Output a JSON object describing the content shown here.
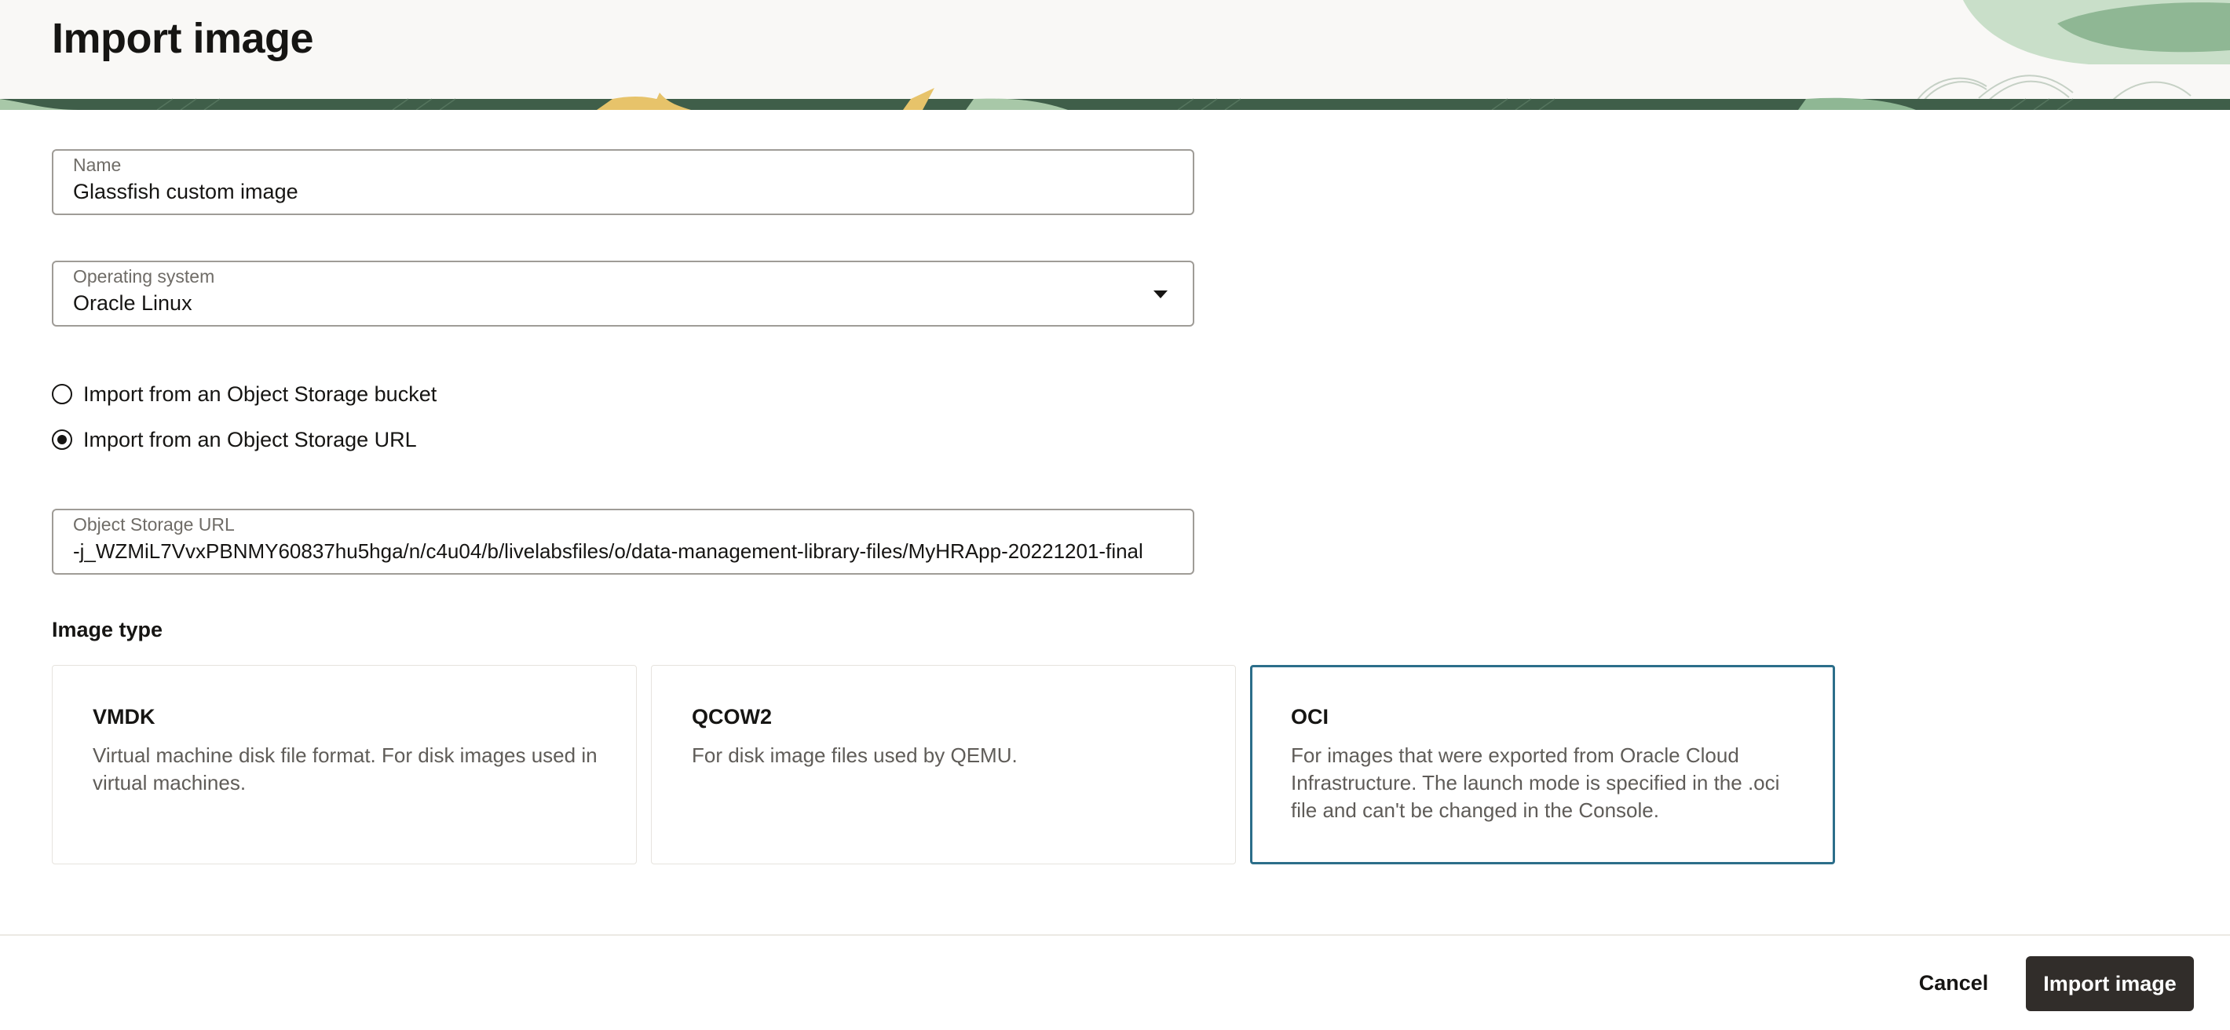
{
  "header": {
    "title": "Import image"
  },
  "form": {
    "name": {
      "label": "Name",
      "value": "Glassfish custom image"
    },
    "os": {
      "label": "Operating system",
      "value": "Oracle Linux"
    },
    "source": {
      "options": [
        {
          "label": "Import from an Object Storage bucket",
          "checked": false
        },
        {
          "label": "Import from an Object Storage URL",
          "checked": true
        }
      ]
    },
    "url": {
      "label": "Object Storage URL",
      "value": "-j_WZMiL7VvxPBNMY60837hu5hga/n/c4u04/b/livelabsfiles/o/data-management-library-files/MyHRApp-20221201-final"
    }
  },
  "image_type": {
    "label": "Image type",
    "options": [
      {
        "title": "VMDK",
        "description": "Virtual machine disk file format. For disk images used in virtual machines.",
        "selected": false
      },
      {
        "title": "QCOW2",
        "description": "For disk image files used by QEMU.",
        "selected": false
      },
      {
        "title": "OCI",
        "description": "For images that were exported from Oracle Cloud Infrastructure. The launch mode is specified in the .oci file and can't be changed in the Console.",
        "selected": true
      }
    ]
  },
  "footer": {
    "cancel_label": "Cancel",
    "submit_label": "Import image"
  },
  "colors": {
    "accent_selected": "#2c6e8a",
    "primary_button": "#312d2a",
    "header_band_green": "#3b5b47"
  }
}
